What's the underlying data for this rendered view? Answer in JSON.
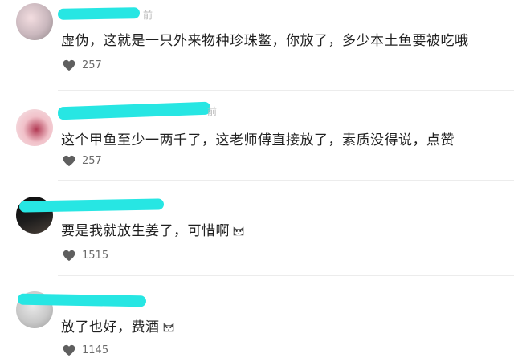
{
  "comments": [
    {
      "meta_fragment": "前",
      "text": "虚伪，这就是一只外来物种珍珠鳖，你放了，多少本土鱼要被吃哦",
      "likes": "257",
      "emoji": ""
    },
    {
      "meta_fragment": "前",
      "text": "这个甲鱼至少一两千了，这老师傅直接放了，素质没得说，点赞",
      "likes": "257",
      "emoji": ""
    },
    {
      "meta_fragment": "",
      "text": "要是我就放生姜了，可惜啊",
      "likes": "1515",
      "emoji": "cat-face-icon"
    },
    {
      "meta_fragment": "",
      "text": "放了也好，费酒",
      "likes": "1145",
      "emoji": "cat-face-icon"
    }
  ],
  "colors": {
    "scribble": "#27e6e3",
    "text": "#1f1f1f",
    "meta": "#b8b8b8",
    "count": "#6a6a6a"
  }
}
